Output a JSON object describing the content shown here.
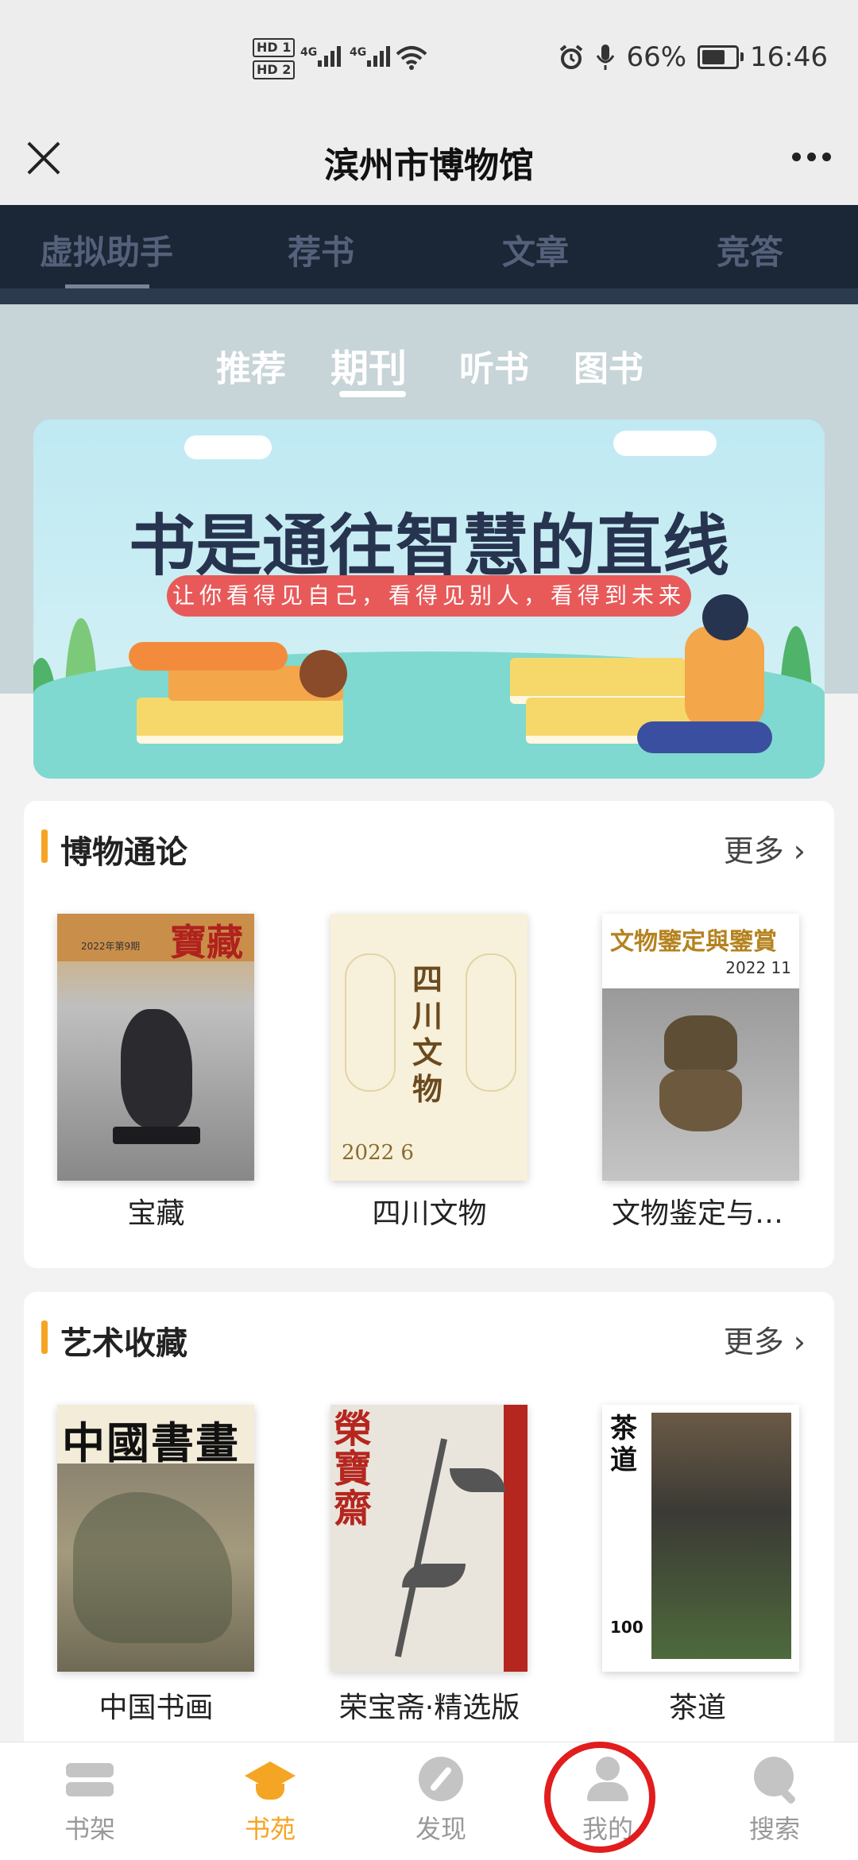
{
  "status_bar": {
    "hd1": "HD 1",
    "hd2": "HD 2",
    "net1": "4G",
    "net2": "4G",
    "battery": "66%",
    "time": "16:46"
  },
  "header": {
    "title": "滨州市博物馆"
  },
  "top_tabs": [
    "虚拟助手",
    "荐书",
    "文章",
    "竞答"
  ],
  "sub_tabs": {
    "items": [
      "推荐",
      "期刊",
      "听书",
      "图书"
    ],
    "active": "期刊"
  },
  "banner": {
    "title": "书是通往智慧的直线",
    "subtitle": "让你看得见自己，看得见别人，看得到未来"
  },
  "sections": [
    {
      "title": "博物通论",
      "more": "更多",
      "items": [
        {
          "title": "宝藏",
          "cover_text": "寶藏",
          "cover_year": "2022年第9期"
        },
        {
          "title": "四川文物",
          "cover_text": "四川文物",
          "cover_year": "2022 6"
        },
        {
          "title": "文物鉴定与…",
          "cover_text": "文物鑒定與鑒賞",
          "cover_year": "2022 11"
        }
      ]
    },
    {
      "title": "艺术收藏",
      "more": "更多",
      "items": [
        {
          "title": "中国书画",
          "cover_text": "中國書畫",
          "cover_year": ""
        },
        {
          "title": "荣宝斋·精选版",
          "cover_text": "榮寶齋",
          "cover_year": ""
        },
        {
          "title": "茶道",
          "cover_text": "茶道",
          "cover_year": "100"
        }
      ]
    }
  ],
  "bottom_nav": {
    "items": [
      {
        "label": "书架",
        "icon": "bookshelf-icon"
      },
      {
        "label": "书苑",
        "icon": "graduation-cap-icon"
      },
      {
        "label": "发现",
        "icon": "compass-icon"
      },
      {
        "label": "我的",
        "icon": "user-icon"
      },
      {
        "label": "搜索",
        "icon": "search-icon"
      }
    ],
    "active": "书苑"
  },
  "colors": {
    "accent": "#f5a524",
    "dark_tabs": "#1b2636",
    "annotation": "#e11d1d"
  }
}
